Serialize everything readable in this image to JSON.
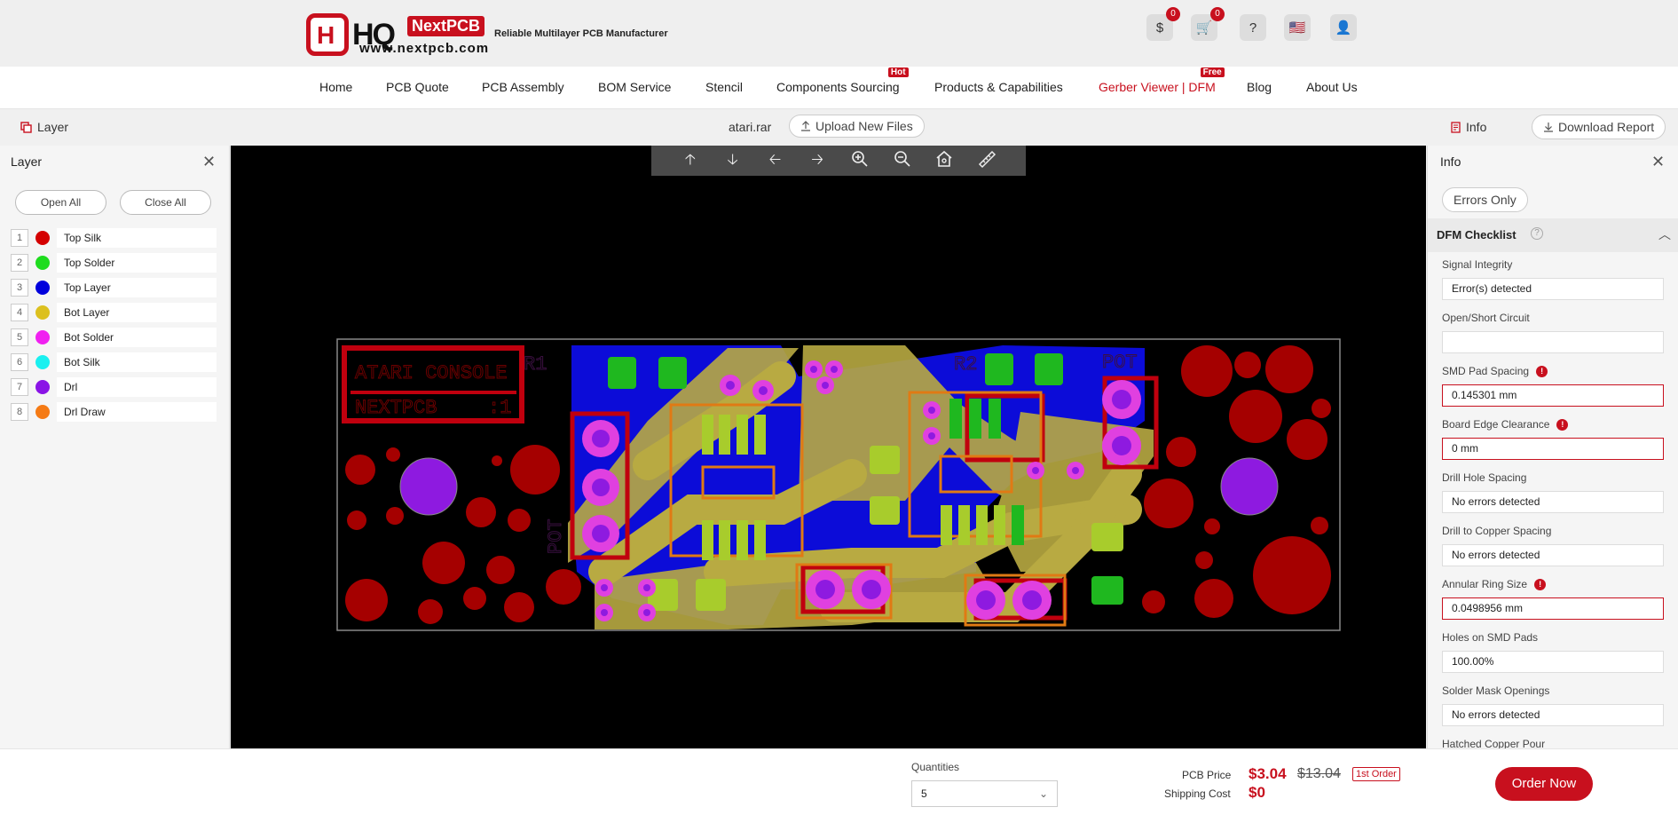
{
  "header": {
    "logo_badge": "H",
    "logo_hq": "HQ",
    "logo_next": "NextPCB",
    "logo_url": "www.nextpcb.com",
    "tagline": "Reliable Multilayer PCB Manufacturer",
    "icons": [
      {
        "name": "quote-icon",
        "glyph": "$",
        "badge": "0"
      },
      {
        "name": "cart-icon",
        "glyph": "🛒",
        "badge": "0"
      },
      {
        "name": "help-icon",
        "glyph": "?"
      },
      {
        "name": "us-flag-icon",
        "glyph": "🇺🇸"
      },
      {
        "name": "user-icon",
        "glyph": "👤"
      }
    ]
  },
  "nav": {
    "items": [
      {
        "label": "Home"
      },
      {
        "label": "PCB Quote"
      },
      {
        "label": "PCB Assembly"
      },
      {
        "label": "BOM Service"
      },
      {
        "label": "Stencil"
      },
      {
        "label": "Components Sourcing",
        "tag": "Hot"
      },
      {
        "label": "Products & Capabilities"
      },
      {
        "label": "Gerber Viewer | DFM",
        "tag": "Free",
        "active": true
      },
      {
        "label": "Blog"
      },
      {
        "label": "About Us"
      }
    ]
  },
  "subbar": {
    "layer_label": "Layer",
    "filename": "atari.rar",
    "upload_label": "Upload New Files",
    "info_label": "Info",
    "download_label": "Download Report"
  },
  "layer_panel": {
    "title": "Layer",
    "open_all": "Open All",
    "close_all": "Close All",
    "layers": [
      {
        "num": "1",
        "name": "Top Silk",
        "color": "#d40000"
      },
      {
        "num": "2",
        "name": "Top Solder",
        "color": "#1edc1e"
      },
      {
        "num": "3",
        "name": "Top Layer",
        "color": "#0000dc"
      },
      {
        "num": "4",
        "name": "Bot Layer",
        "color": "#dcc01e"
      },
      {
        "num": "5",
        "name": "Bot Solder",
        "color": "#f020f0"
      },
      {
        "num": "6",
        "name": "Bot Silk",
        "color": "#19f0f0"
      },
      {
        "num": "7",
        "name": "Drl",
        "color": "#8a14e6"
      },
      {
        "num": "8",
        "name": "Drl Draw",
        "color": "#f57a14"
      }
    ]
  },
  "viewer": {
    "tools": [
      "arrow-up-icon",
      "arrow-down-icon",
      "arrow-left-icon",
      "arrow-right-icon",
      "zoom-in-icon",
      "zoom-out-icon",
      "home-fit-icon",
      "ruler-icon"
    ],
    "board_text_1": "ATARI CONSOLE",
    "board_text_2": "NEXTPCB",
    "board_text_3": ":1",
    "board_text_pot": "POT",
    "board_text_r1": "R1",
    "board_text_r2": "R2",
    "board_text_pot2": "POT"
  },
  "info_panel": {
    "title": "Info",
    "errors_only": "Errors Only",
    "dfm_title": "DFM Checklist",
    "items": [
      {
        "label": "Signal Integrity",
        "value": "Error(s) detected",
        "error": false,
        "warn": false
      },
      {
        "label": "Open/Short Circuit",
        "value": "",
        "error": false,
        "warn": false
      },
      {
        "label": "SMD Pad Spacing",
        "value": "0.145301 mm",
        "error": true,
        "warn": true
      },
      {
        "label": "Board Edge Clearance",
        "value": "0 mm",
        "error": true,
        "warn": true
      },
      {
        "label": "Drill Hole Spacing",
        "value": "No errors detected",
        "error": false,
        "warn": false
      },
      {
        "label": "Drill to Copper Spacing",
        "value": "No errors detected",
        "error": false,
        "warn": false
      },
      {
        "label": "Annular Ring Size",
        "value": "0.0498956 mm",
        "error": true,
        "warn": true
      },
      {
        "label": "Holes on SMD Pads",
        "value": "100.00%",
        "error": false,
        "warn": false
      },
      {
        "label": "Solder Mask Openings",
        "value": "No errors detected",
        "error": false,
        "warn": false
      },
      {
        "label": "Hatched Copper Pour",
        "value": "",
        "error": false,
        "warn": false
      }
    ]
  },
  "order": {
    "qty_label": "Quantities",
    "qty_value": "5",
    "pcb_price_label": "PCB Price",
    "shipping_label": "Shipping Cost",
    "price_now": "$3.04",
    "price_old": "$13.04",
    "first_order": "1st Order",
    "shipping_cost": "$0",
    "order_btn": "Order Now"
  }
}
